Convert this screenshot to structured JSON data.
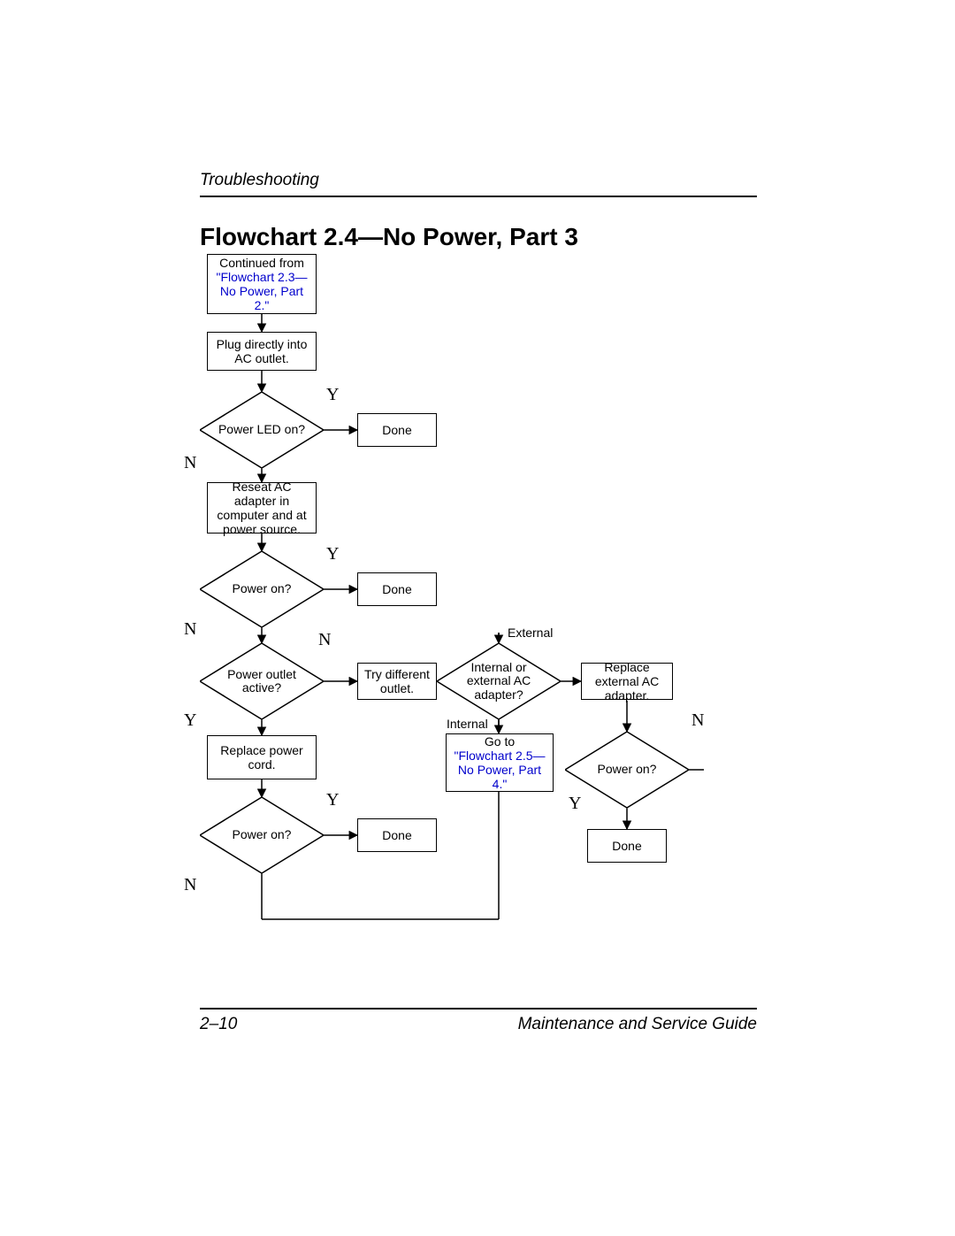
{
  "header": {
    "section": "Troubleshooting"
  },
  "footer": {
    "page": "2–10",
    "guide": "Maintenance and Service Guide"
  },
  "title": "Flowchart 2.4—No Power, Part 3",
  "nodes": {
    "continued_prefix": "Continued from",
    "continued_link": "\"Flowchart 2.3—No Power, Part 2.\"",
    "plug": "Plug directly into AC outlet.",
    "led": "Power LED on?",
    "done1": "Done",
    "reseat": "Reseat AC adapter in computer and at power source.",
    "power1": "Power on?",
    "done2": "Done",
    "active": "Power outlet active?",
    "try": "Try different outlet.",
    "intext": "Internal or external AC adapter?",
    "replace_ext": "Replace external AC adapter.",
    "goto_prefix": "Go to",
    "goto_link": "\"Flowchart 2.5—No Power, Part 4.\"",
    "power2": "Power on?",
    "done3": "Done",
    "replace_cord": "Replace power cord.",
    "power3": "Power on?",
    "done4": "Done"
  },
  "labels": {
    "Y": "Y",
    "N": "N",
    "External": "External",
    "Internal": "Internal"
  }
}
